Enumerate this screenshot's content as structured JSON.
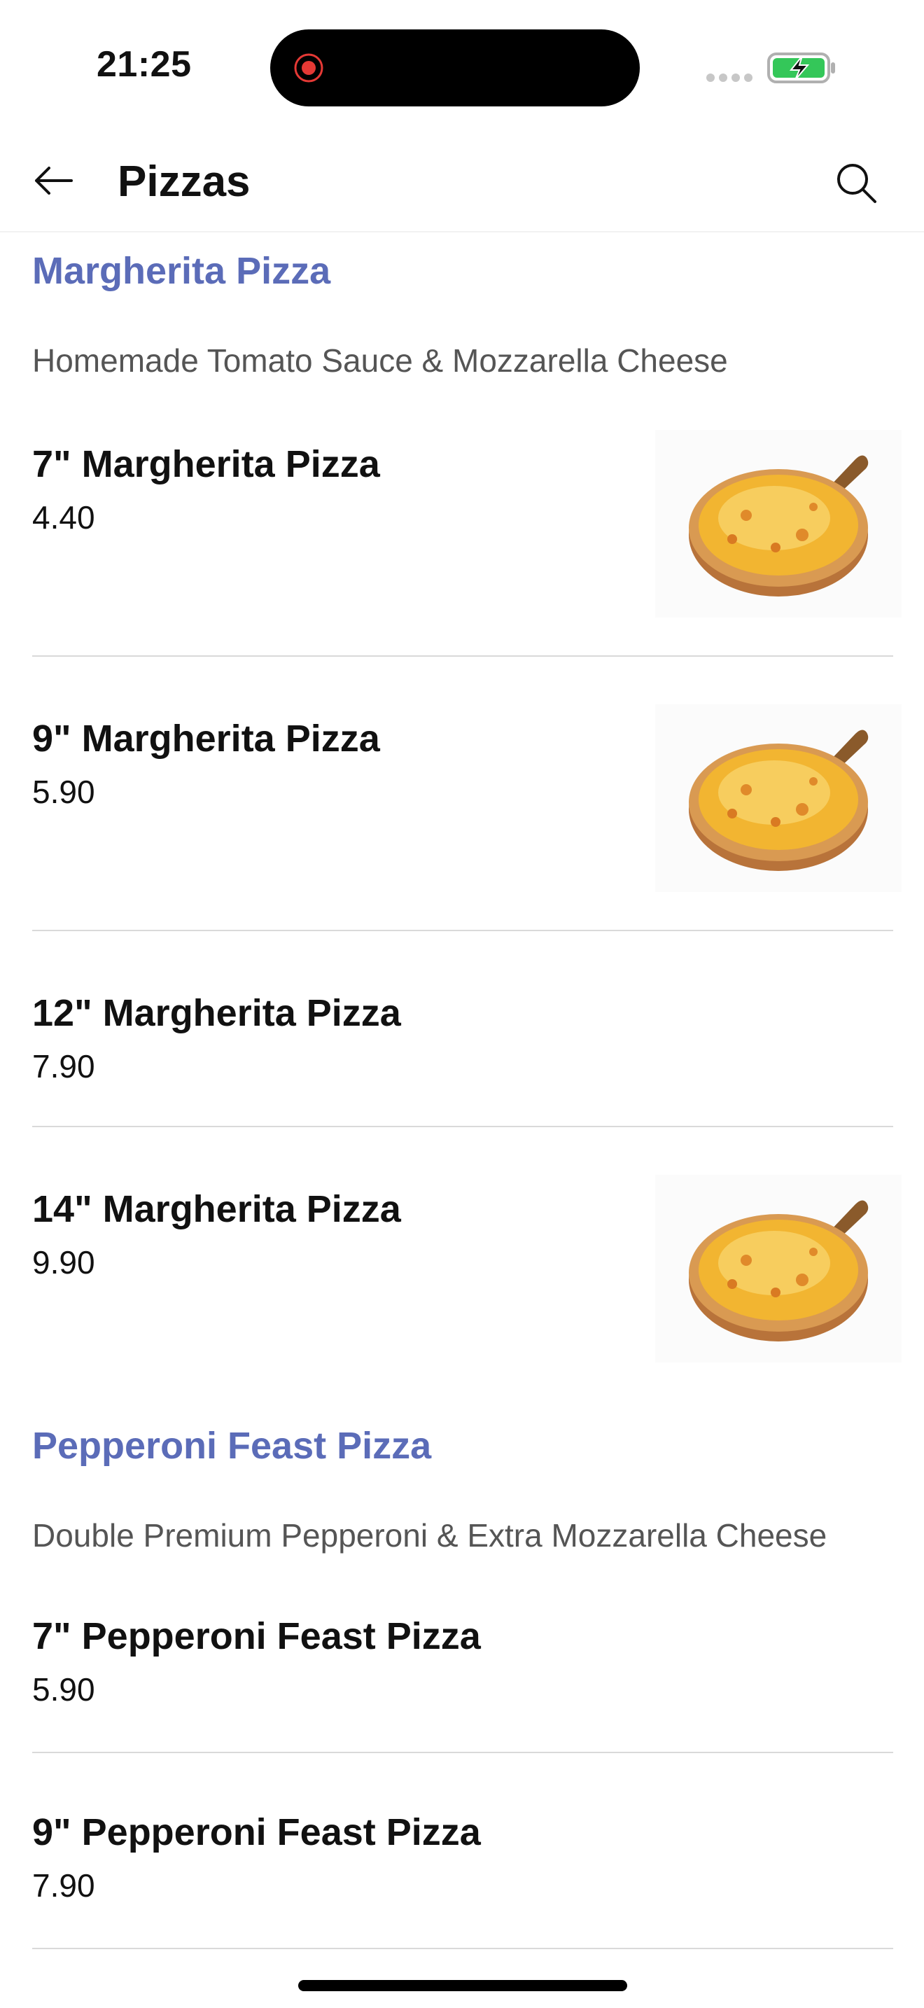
{
  "status_bar": {
    "time": "21:25"
  },
  "header": {
    "title": "Pizzas",
    "back_icon": "arrow-left-icon",
    "search_icon": "search-icon"
  },
  "sections": [
    {
      "title": "Margherita Pizza",
      "description": "Homemade Tomato Sauce & Mozzarella Cheese",
      "items": [
        {
          "name": "7\" Margherita Pizza",
          "price": "4.40",
          "has_image": true
        },
        {
          "name": "9\" Margherita Pizza",
          "price": "5.90",
          "has_image": true
        },
        {
          "name": "12\" Margherita Pizza",
          "price": "7.90",
          "has_image": false
        },
        {
          "name": "14\" Margherita Pizza",
          "price": "9.90",
          "has_image": true
        }
      ]
    },
    {
      "title": "Pepperoni Feast Pizza",
      "description": "Double Premium Pepperoni & Extra Mozzarella Cheese",
      "items": [
        {
          "name": "7\" Pepperoni Feast Pizza",
          "price": "5.90",
          "has_image": false
        },
        {
          "name": "9\" Pepperoni Feast Pizza",
          "price": "7.90",
          "has_image": false
        }
      ]
    }
  ],
  "colors": {
    "section_title": "#5b6cb8",
    "divider": "#d9d9d9",
    "battery_green": "#34c759"
  }
}
